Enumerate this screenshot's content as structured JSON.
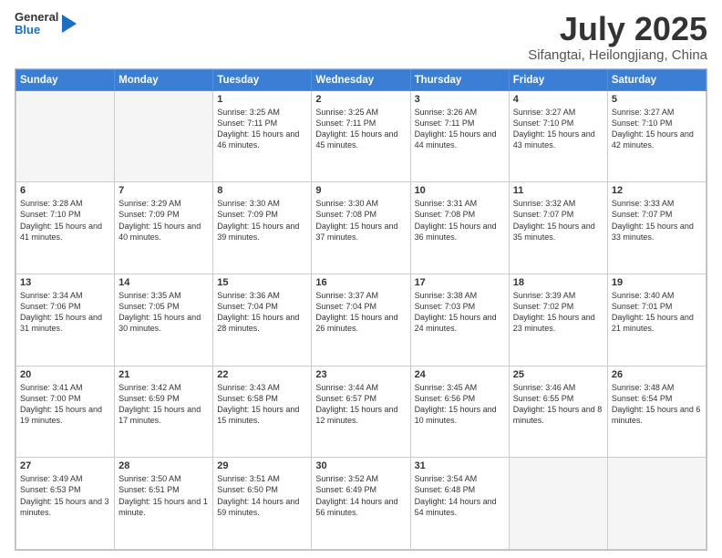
{
  "logo": {
    "general": "General",
    "blue": "Blue"
  },
  "title": "July 2025",
  "subtitle": "Sifangtai, Heilongjiang, China",
  "days_of_week": [
    "Sunday",
    "Monday",
    "Tuesday",
    "Wednesday",
    "Thursday",
    "Friday",
    "Saturday"
  ],
  "weeks": [
    [
      {
        "day": "",
        "info": ""
      },
      {
        "day": "",
        "info": ""
      },
      {
        "day": "1",
        "info": "Sunrise: 3:25 AM\nSunset: 7:11 PM\nDaylight: 15 hours and 46 minutes."
      },
      {
        "day": "2",
        "info": "Sunrise: 3:25 AM\nSunset: 7:11 PM\nDaylight: 15 hours and 45 minutes."
      },
      {
        "day": "3",
        "info": "Sunrise: 3:26 AM\nSunset: 7:11 PM\nDaylight: 15 hours and 44 minutes."
      },
      {
        "day": "4",
        "info": "Sunrise: 3:27 AM\nSunset: 7:10 PM\nDaylight: 15 hours and 43 minutes."
      },
      {
        "day": "5",
        "info": "Sunrise: 3:27 AM\nSunset: 7:10 PM\nDaylight: 15 hours and 42 minutes."
      }
    ],
    [
      {
        "day": "6",
        "info": "Sunrise: 3:28 AM\nSunset: 7:10 PM\nDaylight: 15 hours and 41 minutes."
      },
      {
        "day": "7",
        "info": "Sunrise: 3:29 AM\nSunset: 7:09 PM\nDaylight: 15 hours and 40 minutes."
      },
      {
        "day": "8",
        "info": "Sunrise: 3:30 AM\nSunset: 7:09 PM\nDaylight: 15 hours and 39 minutes."
      },
      {
        "day": "9",
        "info": "Sunrise: 3:30 AM\nSunset: 7:08 PM\nDaylight: 15 hours and 37 minutes."
      },
      {
        "day": "10",
        "info": "Sunrise: 3:31 AM\nSunset: 7:08 PM\nDaylight: 15 hours and 36 minutes."
      },
      {
        "day": "11",
        "info": "Sunrise: 3:32 AM\nSunset: 7:07 PM\nDaylight: 15 hours and 35 minutes."
      },
      {
        "day": "12",
        "info": "Sunrise: 3:33 AM\nSunset: 7:07 PM\nDaylight: 15 hours and 33 minutes."
      }
    ],
    [
      {
        "day": "13",
        "info": "Sunrise: 3:34 AM\nSunset: 7:06 PM\nDaylight: 15 hours and 31 minutes."
      },
      {
        "day": "14",
        "info": "Sunrise: 3:35 AM\nSunset: 7:05 PM\nDaylight: 15 hours and 30 minutes."
      },
      {
        "day": "15",
        "info": "Sunrise: 3:36 AM\nSunset: 7:04 PM\nDaylight: 15 hours and 28 minutes."
      },
      {
        "day": "16",
        "info": "Sunrise: 3:37 AM\nSunset: 7:04 PM\nDaylight: 15 hours and 26 minutes."
      },
      {
        "day": "17",
        "info": "Sunrise: 3:38 AM\nSunset: 7:03 PM\nDaylight: 15 hours and 24 minutes."
      },
      {
        "day": "18",
        "info": "Sunrise: 3:39 AM\nSunset: 7:02 PM\nDaylight: 15 hours and 23 minutes."
      },
      {
        "day": "19",
        "info": "Sunrise: 3:40 AM\nSunset: 7:01 PM\nDaylight: 15 hours and 21 minutes."
      }
    ],
    [
      {
        "day": "20",
        "info": "Sunrise: 3:41 AM\nSunset: 7:00 PM\nDaylight: 15 hours and 19 minutes."
      },
      {
        "day": "21",
        "info": "Sunrise: 3:42 AM\nSunset: 6:59 PM\nDaylight: 15 hours and 17 minutes."
      },
      {
        "day": "22",
        "info": "Sunrise: 3:43 AM\nSunset: 6:58 PM\nDaylight: 15 hours and 15 minutes."
      },
      {
        "day": "23",
        "info": "Sunrise: 3:44 AM\nSunset: 6:57 PM\nDaylight: 15 hours and 12 minutes."
      },
      {
        "day": "24",
        "info": "Sunrise: 3:45 AM\nSunset: 6:56 PM\nDaylight: 15 hours and 10 minutes."
      },
      {
        "day": "25",
        "info": "Sunrise: 3:46 AM\nSunset: 6:55 PM\nDaylight: 15 hours and 8 minutes."
      },
      {
        "day": "26",
        "info": "Sunrise: 3:48 AM\nSunset: 6:54 PM\nDaylight: 15 hours and 6 minutes."
      }
    ],
    [
      {
        "day": "27",
        "info": "Sunrise: 3:49 AM\nSunset: 6:53 PM\nDaylight: 15 hours and 3 minutes."
      },
      {
        "day": "28",
        "info": "Sunrise: 3:50 AM\nSunset: 6:51 PM\nDaylight: 15 hours and 1 minute."
      },
      {
        "day": "29",
        "info": "Sunrise: 3:51 AM\nSunset: 6:50 PM\nDaylight: 14 hours and 59 minutes."
      },
      {
        "day": "30",
        "info": "Sunrise: 3:52 AM\nSunset: 6:49 PM\nDaylight: 14 hours and 56 minutes."
      },
      {
        "day": "31",
        "info": "Sunrise: 3:54 AM\nSunset: 6:48 PM\nDaylight: 14 hours and 54 minutes."
      },
      {
        "day": "",
        "info": ""
      },
      {
        "day": "",
        "info": ""
      }
    ]
  ]
}
